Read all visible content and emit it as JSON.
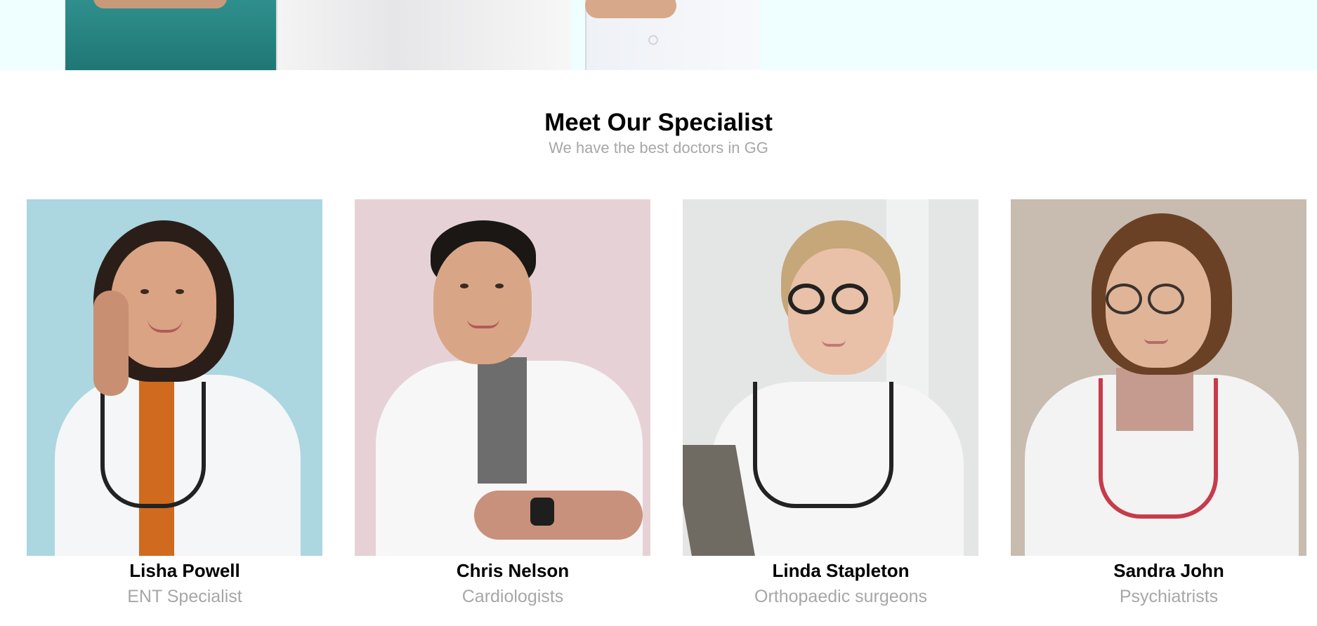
{
  "section": {
    "title": "Meet Our Specialist",
    "subtitle": "We have the best doctors in GG"
  },
  "specialists": [
    {
      "name": "Lisha Powell",
      "role": "ENT Specialist",
      "photo_bg": "#acd6e0"
    },
    {
      "name": "Chris Nelson",
      "role": "Cardiologists",
      "photo_bg": "#e6d2d6"
    },
    {
      "name": "Linda Stapleton",
      "role": "Orthopaedic surgeons",
      "photo_bg": "#e3e6e5"
    },
    {
      "name": "Sandra John",
      "role": "Psychiatrists",
      "photo_bg": "#c8bbb0"
    }
  ],
  "colors": {
    "hero_bg": "#effefe",
    "heading": "#000000",
    "muted": "#a7a7a7"
  }
}
